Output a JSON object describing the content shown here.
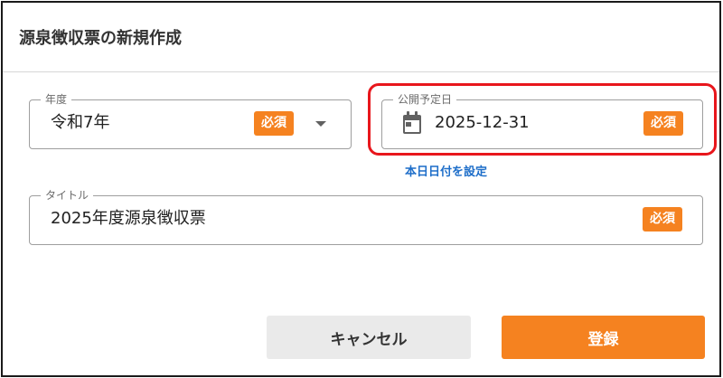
{
  "dialog": {
    "title": "源泉徴収票の新規作成"
  },
  "fields": {
    "year": {
      "label": "年度",
      "value": "令和7年",
      "required": "必須"
    },
    "publish_date": {
      "label": "公開予定日",
      "value": "2025-12-31",
      "required": "必須",
      "set_today_link": "本日日付を設定"
    },
    "title": {
      "label": "タイトル",
      "value": "2025年度源泉徴収票",
      "required": "必須"
    }
  },
  "buttons": {
    "cancel": "キャンセル",
    "register": "登録"
  },
  "colors": {
    "accent": "#f58220",
    "link": "#1e6ec9",
    "highlight": "#e8161c"
  },
  "icons": {
    "dropdown": "triangle-down-icon",
    "calendar": "calendar-icon"
  }
}
